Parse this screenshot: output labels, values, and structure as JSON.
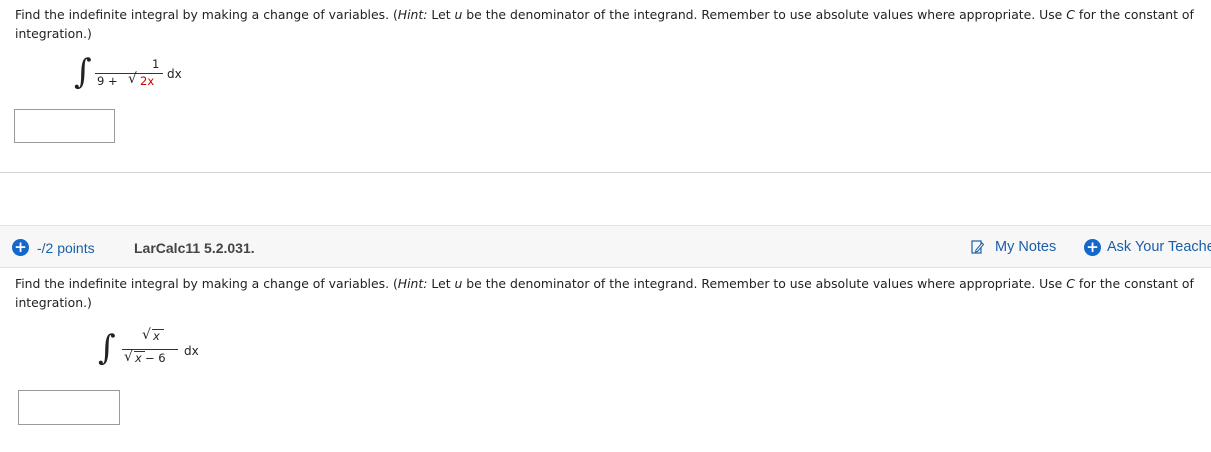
{
  "q1": {
    "text_before_hint": "Find the indefinite integral by making a change of variables. (",
    "hint_label": "Hint:",
    "hint_text_1": " Let ",
    "hint_var": "u",
    "hint_text_2": " be the denominator of the integrand. Remember to use absolute values where appropriate. Use ",
    "const_var": "C",
    "text_after": " for the constant of integration.)",
    "numerator": "1",
    "denominator_prefix": "9 + ",
    "radicand": "2x",
    "dx": "dx",
    "answer_value": ""
  },
  "q2": {
    "points": "-/2 points",
    "id": "LarCalc11 5.2.031.",
    "my_notes": "My Notes",
    "ask_teacher": "Ask Your Teacher",
    "text_before_hint": "Find the indefinite integral by making a change of variables. (",
    "hint_label": "Hint:",
    "hint_text_1": " Let ",
    "hint_var": "u",
    "hint_text_2": " be the denominator of the integrand. Remember to use absolute values where appropriate. Use ",
    "const_var": "C",
    "text_after": " for the constant of integration.)",
    "numerator_radicand": "x",
    "denominator_radicand": "x",
    "denominator_suffix": " − 6",
    "dx": "dx",
    "answer_value": ""
  },
  "colors": {
    "link_blue": "#1a5faa",
    "icon_blue": "#1468c9",
    "red_term": "#cc0000"
  },
  "icons": {
    "plus": "+",
    "notes": "notes-icon"
  }
}
